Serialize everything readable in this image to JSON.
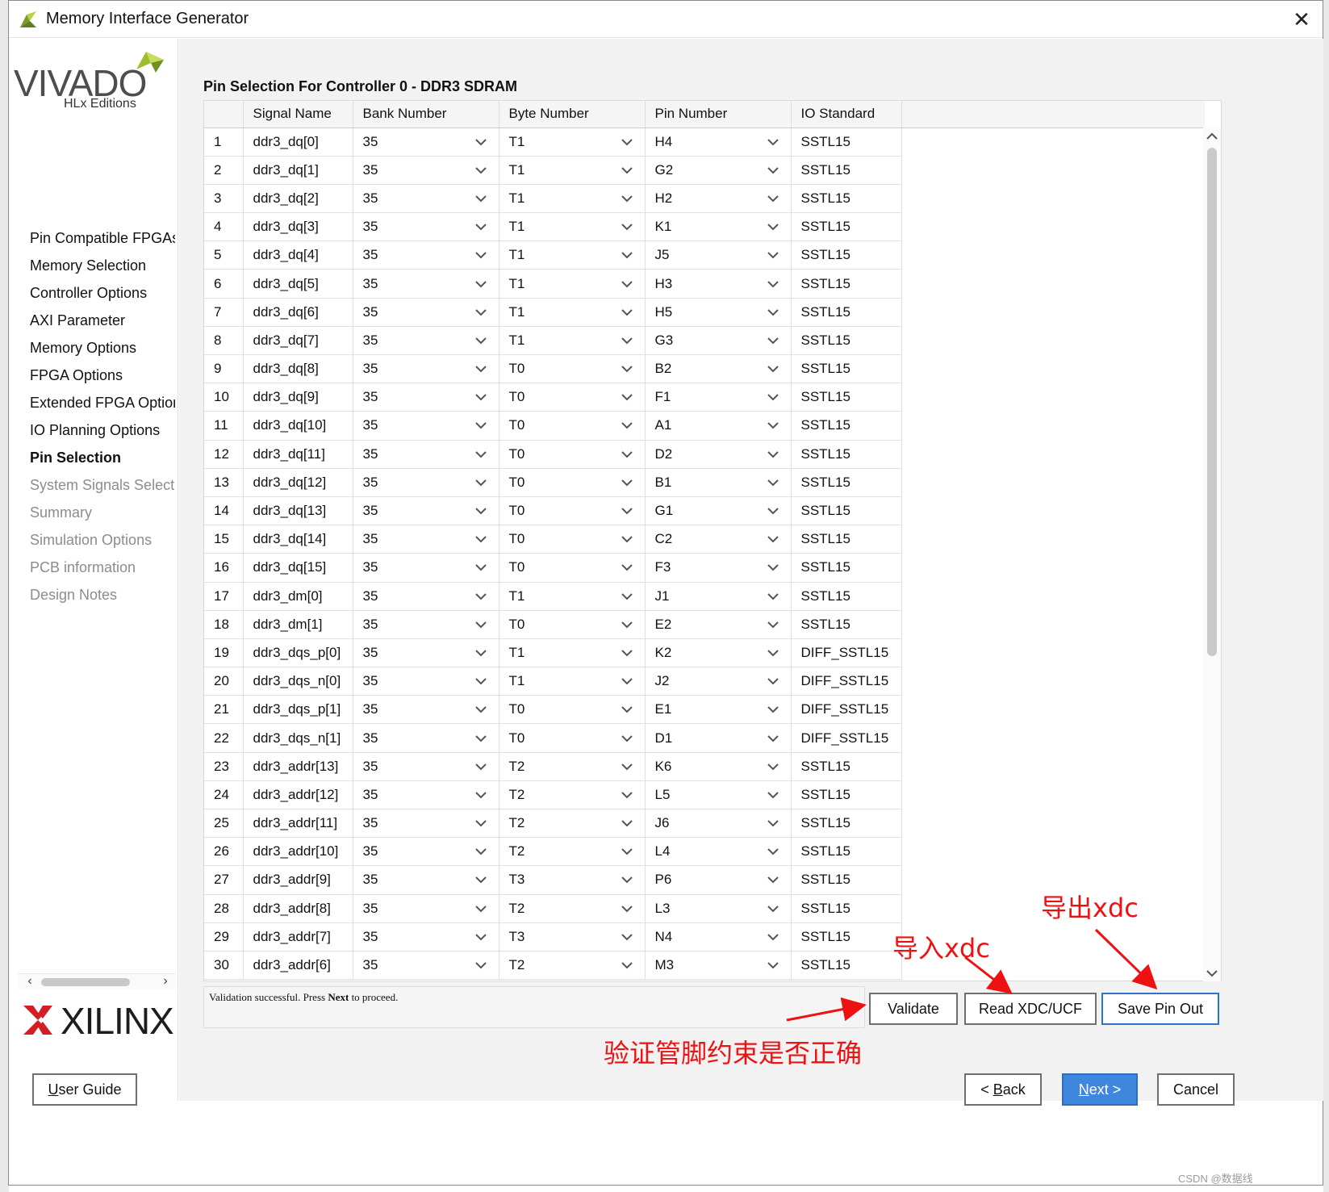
{
  "window": {
    "title": "Memory Interface Generator",
    "close": "✕"
  },
  "logo": {
    "product": "VIVADO",
    "edition": "HLx Editions",
    "vendor": "XILINX"
  },
  "sidebar": {
    "items": [
      {
        "label": "Pin Compatible FPGAs",
        "state": "done"
      },
      {
        "label": "Memory Selection",
        "state": "done"
      },
      {
        "label": "Controller Options",
        "state": "done"
      },
      {
        "label": "AXI Parameter",
        "state": "done"
      },
      {
        "label": "Memory Options",
        "state": "done"
      },
      {
        "label": "FPGA Options",
        "state": "done"
      },
      {
        "label": "Extended FPGA Options",
        "state": "done"
      },
      {
        "label": "IO Planning Options",
        "state": "done"
      },
      {
        "label": "Pin Selection",
        "state": "active"
      },
      {
        "label": "System Signals Selection",
        "state": "future"
      },
      {
        "label": "Summary",
        "state": "future"
      },
      {
        "label": "Simulation Options",
        "state": "future"
      },
      {
        "label": "PCB information",
        "state": "future"
      },
      {
        "label": "Design Notes",
        "state": "future"
      }
    ]
  },
  "main": {
    "section_title": "Pin Selection For Controller 0 - DDR3 SDRAM",
    "columns": [
      "",
      "Signal Name",
      "Bank Number",
      "Byte Number",
      "Pin Number",
      "IO Standard"
    ],
    "rows": [
      [
        "1",
        "ddr3_dq[0]",
        "35",
        "T1",
        "H4",
        "SSTL15"
      ],
      [
        "2",
        "ddr3_dq[1]",
        "35",
        "T1",
        "G2",
        "SSTL15"
      ],
      [
        "3",
        "ddr3_dq[2]",
        "35",
        "T1",
        "H2",
        "SSTL15"
      ],
      [
        "4",
        "ddr3_dq[3]",
        "35",
        "T1",
        "K1",
        "SSTL15"
      ],
      [
        "5",
        "ddr3_dq[4]",
        "35",
        "T1",
        "J5",
        "SSTL15"
      ],
      [
        "6",
        "ddr3_dq[5]",
        "35",
        "T1",
        "H3",
        "SSTL15"
      ],
      [
        "7",
        "ddr3_dq[6]",
        "35",
        "T1",
        "H5",
        "SSTL15"
      ],
      [
        "8",
        "ddr3_dq[7]",
        "35",
        "T1",
        "G3",
        "SSTL15"
      ],
      [
        "9",
        "ddr3_dq[8]",
        "35",
        "T0",
        "B2",
        "SSTL15"
      ],
      [
        "10",
        "ddr3_dq[9]",
        "35",
        "T0",
        "F1",
        "SSTL15"
      ],
      [
        "11",
        "ddr3_dq[10]",
        "35",
        "T0",
        "A1",
        "SSTL15"
      ],
      [
        "12",
        "ddr3_dq[11]",
        "35",
        "T0",
        "D2",
        "SSTL15"
      ],
      [
        "13",
        "ddr3_dq[12]",
        "35",
        "T0",
        "B1",
        "SSTL15"
      ],
      [
        "14",
        "ddr3_dq[13]",
        "35",
        "T0",
        "G1",
        "SSTL15"
      ],
      [
        "15",
        "ddr3_dq[14]",
        "35",
        "T0",
        "C2",
        "SSTL15"
      ],
      [
        "16",
        "ddr3_dq[15]",
        "35",
        "T0",
        "F3",
        "SSTL15"
      ],
      [
        "17",
        "ddr3_dm[0]",
        "35",
        "T1",
        "J1",
        "SSTL15"
      ],
      [
        "18",
        "ddr3_dm[1]",
        "35",
        "T0",
        "E2",
        "SSTL15"
      ],
      [
        "19",
        "ddr3_dqs_p[0]",
        "35",
        "T1",
        "K2",
        "DIFF_SSTL15"
      ],
      [
        "20",
        "ddr3_dqs_n[0]",
        "35",
        "T1",
        "J2",
        "DIFF_SSTL15"
      ],
      [
        "21",
        "ddr3_dqs_p[1]",
        "35",
        "T0",
        "E1",
        "DIFF_SSTL15"
      ],
      [
        "22",
        "ddr3_dqs_n[1]",
        "35",
        "T0",
        "D1",
        "DIFF_SSTL15"
      ],
      [
        "23",
        "ddr3_addr[13]",
        "35",
        "T2",
        "K6",
        "SSTL15"
      ],
      [
        "24",
        "ddr3_addr[12]",
        "35",
        "T2",
        "L5",
        "SSTL15"
      ],
      [
        "25",
        "ddr3_addr[11]",
        "35",
        "T2",
        "J6",
        "SSTL15"
      ],
      [
        "26",
        "ddr3_addr[10]",
        "35",
        "T2",
        "L4",
        "SSTL15"
      ],
      [
        "27",
        "ddr3_addr[9]",
        "35",
        "T3",
        "P6",
        "SSTL15"
      ],
      [
        "28",
        "ddr3_addr[8]",
        "35",
        "T2",
        "L3",
        "SSTL15"
      ],
      [
        "29",
        "ddr3_addr[7]",
        "35",
        "T3",
        "N4",
        "SSTL15"
      ],
      [
        "30",
        "ddr3_addr[6]",
        "35",
        "T2",
        "M3",
        "SSTL15"
      ]
    ],
    "status_prefix": "Validation successful. Press ",
    "status_bold": "Next",
    "status_suffix": " to proceed.",
    "buttons": {
      "validate": "Validate",
      "read_xdc": "Read XDC/UCF",
      "save_pin_out": "Save Pin Out"
    }
  },
  "footer": {
    "user_guide_u": "U",
    "user_guide_rest": "ser Guide",
    "back_prefix": "< ",
    "back_u": "B",
    "back_rest": "ack",
    "next_u": "N",
    "next_rest": "ext >",
    "cancel": "Cancel"
  },
  "annotations": {
    "export": "导出xdc",
    "import": "导入xdc",
    "validate": "验证管脚约束是否正确"
  },
  "watermark": "CSDN @数据线",
  "colors": {
    "accent": "#2d73c9",
    "next_bg": "#3f86dd",
    "annotation": "#ee1111",
    "logo_green": "#a6c43a",
    "xilinx_red": "#d31e25"
  }
}
